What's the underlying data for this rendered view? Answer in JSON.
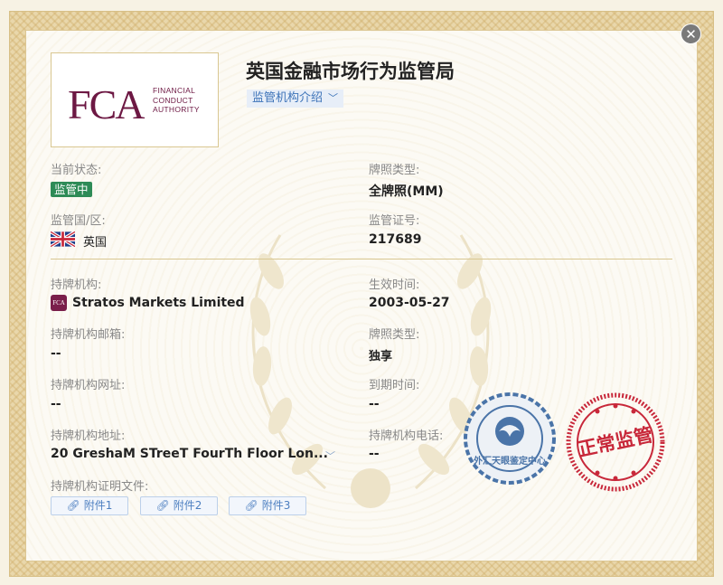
{
  "header": {
    "title": "英国金融市场行为监管局",
    "intro_label": "监管机构介绍"
  },
  "logo": {
    "letters": "FCA",
    "line1": "FINANCIAL",
    "line2": "CONDUCT",
    "line3": "AUTHORITY"
  },
  "status": {
    "label": "当前状态:",
    "value": "监管中",
    "color": "#2e8b57"
  },
  "license_type": {
    "label": "牌照类型:",
    "value": "全牌照(MM)"
  },
  "region": {
    "label": "监管国/区:",
    "value": "英国"
  },
  "license_no": {
    "label": "监管证号:",
    "value": "217689"
  },
  "holder": {
    "label": "持牌机构:",
    "value": "Stratos Markets Limited",
    "icon_text": "FCA"
  },
  "effective": {
    "label": "生效时间:",
    "value": "2003-05-27"
  },
  "email": {
    "label": "持牌机构邮箱:",
    "value": "--"
  },
  "license_kind": {
    "label": "牌照类型:",
    "value": "独享"
  },
  "website": {
    "label": "持牌机构网址:",
    "value": "--"
  },
  "expiry": {
    "label": "到期时间:",
    "value": "--"
  },
  "address": {
    "label": "持牌机构地址:",
    "value": "20 GreshaM STreeT FourTh Floor Lon..."
  },
  "phone": {
    "label": "持牌机构电话:",
    "value": "--"
  },
  "documents": {
    "label": "持牌机构证明文件:",
    "items": [
      "附件1",
      "附件2",
      "附件3"
    ]
  },
  "seals": {
    "blue_text": "外汇天眼鉴定中心",
    "red_text": "正常监管"
  },
  "icons": {
    "close": "close-icon",
    "chevron": "chevron-down-icon",
    "link": "link-icon",
    "flag": "uk-flag-icon"
  },
  "colors": {
    "brand": "#6d1843",
    "accent": "#3d73b8",
    "gold": "#d9c791",
    "seal_red": "#c8283a",
    "seal_blue": "#4a74a8"
  }
}
